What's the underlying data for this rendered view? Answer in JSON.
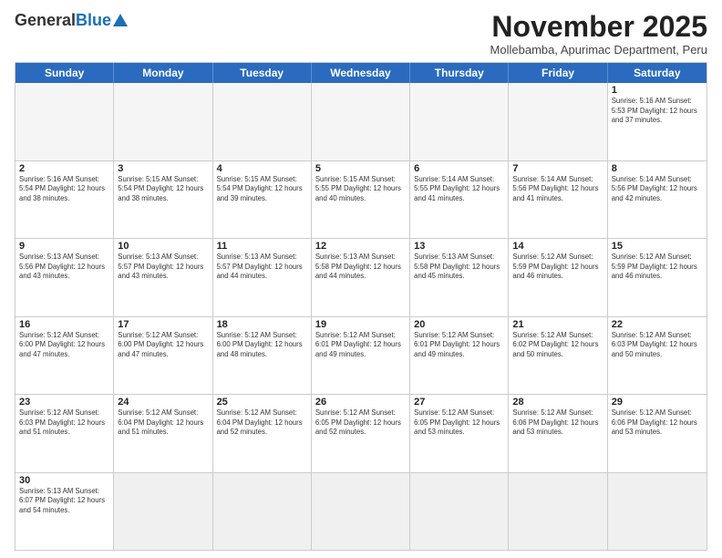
{
  "logo": {
    "general": "General",
    "blue": "Blue"
  },
  "title": {
    "month": "November 2025",
    "location": "Mollebamba, Apurimac Department, Peru"
  },
  "header_days": [
    "Sunday",
    "Monday",
    "Tuesday",
    "Wednesday",
    "Thursday",
    "Friday",
    "Saturday"
  ],
  "weeks": [
    [
      {
        "day": "",
        "info": ""
      },
      {
        "day": "",
        "info": ""
      },
      {
        "day": "",
        "info": ""
      },
      {
        "day": "",
        "info": ""
      },
      {
        "day": "",
        "info": ""
      },
      {
        "day": "",
        "info": ""
      },
      {
        "day": "1",
        "info": "Sunrise: 5:16 AM\nSunset: 5:53 PM\nDaylight: 12 hours and 37 minutes."
      }
    ],
    [
      {
        "day": "2",
        "info": "Sunrise: 5:16 AM\nSunset: 5:54 PM\nDaylight: 12 hours and 38 minutes."
      },
      {
        "day": "3",
        "info": "Sunrise: 5:15 AM\nSunset: 5:54 PM\nDaylight: 12 hours and 38 minutes."
      },
      {
        "day": "4",
        "info": "Sunrise: 5:15 AM\nSunset: 5:54 PM\nDaylight: 12 hours and 39 minutes."
      },
      {
        "day": "5",
        "info": "Sunrise: 5:15 AM\nSunset: 5:55 PM\nDaylight: 12 hours and 40 minutes."
      },
      {
        "day": "6",
        "info": "Sunrise: 5:14 AM\nSunset: 5:55 PM\nDaylight: 12 hours and 41 minutes."
      },
      {
        "day": "7",
        "info": "Sunrise: 5:14 AM\nSunset: 5:56 PM\nDaylight: 12 hours and 41 minutes."
      },
      {
        "day": "8",
        "info": "Sunrise: 5:14 AM\nSunset: 5:56 PM\nDaylight: 12 hours and 42 minutes."
      }
    ],
    [
      {
        "day": "9",
        "info": "Sunrise: 5:13 AM\nSunset: 5:56 PM\nDaylight: 12 hours and 43 minutes."
      },
      {
        "day": "10",
        "info": "Sunrise: 5:13 AM\nSunset: 5:57 PM\nDaylight: 12 hours and 43 minutes."
      },
      {
        "day": "11",
        "info": "Sunrise: 5:13 AM\nSunset: 5:57 PM\nDaylight: 12 hours and 44 minutes."
      },
      {
        "day": "12",
        "info": "Sunrise: 5:13 AM\nSunset: 5:58 PM\nDaylight: 12 hours and 44 minutes."
      },
      {
        "day": "13",
        "info": "Sunrise: 5:13 AM\nSunset: 5:58 PM\nDaylight: 12 hours and 45 minutes."
      },
      {
        "day": "14",
        "info": "Sunrise: 5:12 AM\nSunset: 5:59 PM\nDaylight: 12 hours and 46 minutes."
      },
      {
        "day": "15",
        "info": "Sunrise: 5:12 AM\nSunset: 5:59 PM\nDaylight: 12 hours and 46 minutes."
      }
    ],
    [
      {
        "day": "16",
        "info": "Sunrise: 5:12 AM\nSunset: 6:00 PM\nDaylight: 12 hours and 47 minutes."
      },
      {
        "day": "17",
        "info": "Sunrise: 5:12 AM\nSunset: 6:00 PM\nDaylight: 12 hours and 47 minutes."
      },
      {
        "day": "18",
        "info": "Sunrise: 5:12 AM\nSunset: 6:00 PM\nDaylight: 12 hours and 48 minutes."
      },
      {
        "day": "19",
        "info": "Sunrise: 5:12 AM\nSunset: 6:01 PM\nDaylight: 12 hours and 49 minutes."
      },
      {
        "day": "20",
        "info": "Sunrise: 5:12 AM\nSunset: 6:01 PM\nDaylight: 12 hours and 49 minutes."
      },
      {
        "day": "21",
        "info": "Sunrise: 5:12 AM\nSunset: 6:02 PM\nDaylight: 12 hours and 50 minutes."
      },
      {
        "day": "22",
        "info": "Sunrise: 5:12 AM\nSunset: 6:03 PM\nDaylight: 12 hours and 50 minutes."
      }
    ],
    [
      {
        "day": "23",
        "info": "Sunrise: 5:12 AM\nSunset: 6:03 PM\nDaylight: 12 hours and 51 minutes."
      },
      {
        "day": "24",
        "info": "Sunrise: 5:12 AM\nSunset: 6:04 PM\nDaylight: 12 hours and 51 minutes."
      },
      {
        "day": "25",
        "info": "Sunrise: 5:12 AM\nSunset: 6:04 PM\nDaylight: 12 hours and 52 minutes."
      },
      {
        "day": "26",
        "info": "Sunrise: 5:12 AM\nSunset: 6:05 PM\nDaylight: 12 hours and 52 minutes."
      },
      {
        "day": "27",
        "info": "Sunrise: 5:12 AM\nSunset: 6:05 PM\nDaylight: 12 hours and 53 minutes."
      },
      {
        "day": "28",
        "info": "Sunrise: 5:12 AM\nSunset: 6:06 PM\nDaylight: 12 hours and 53 minutes."
      },
      {
        "day": "29",
        "info": "Sunrise: 5:12 AM\nSunset: 6:06 PM\nDaylight: 12 hours and 53 minutes."
      }
    ],
    [
      {
        "day": "30",
        "info": "Sunrise: 5:13 AM\nSunset: 6:07 PM\nDaylight: 12 hours and 54 minutes."
      },
      {
        "day": "",
        "info": ""
      },
      {
        "day": "",
        "info": ""
      },
      {
        "day": "",
        "info": ""
      },
      {
        "day": "",
        "info": ""
      },
      {
        "day": "",
        "info": ""
      },
      {
        "day": "",
        "info": ""
      }
    ]
  ]
}
